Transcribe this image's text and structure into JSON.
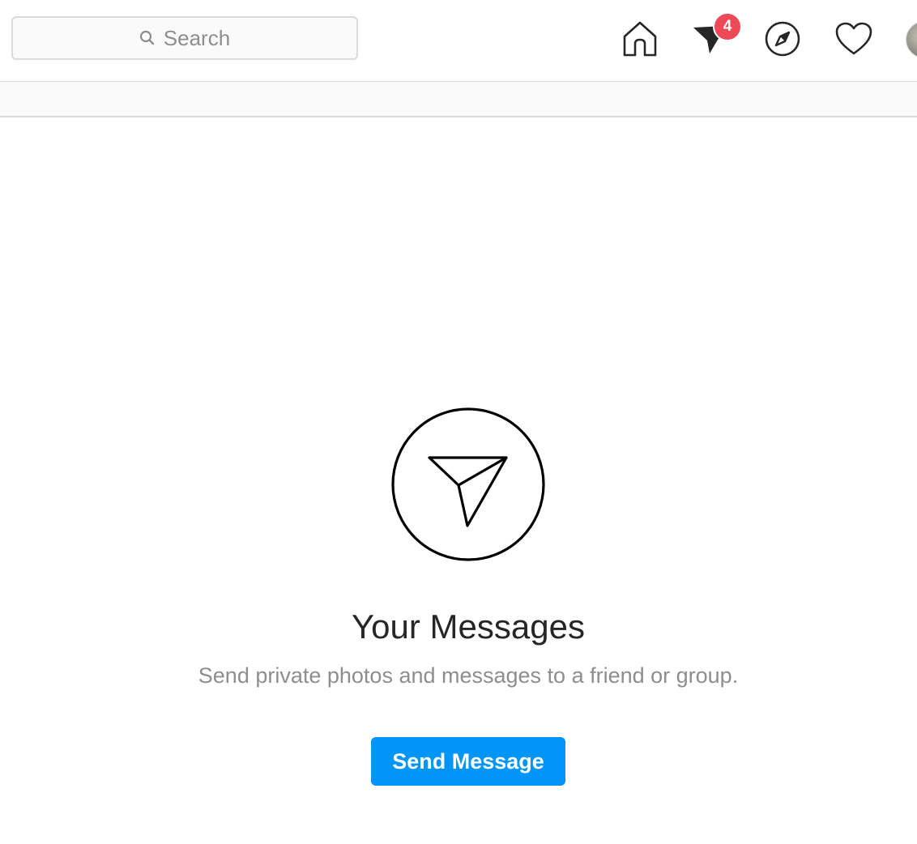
{
  "header": {
    "search": {
      "placeholder": "Search",
      "icon": "search-icon"
    },
    "nav": [
      {
        "name": "home",
        "icon": "home-icon"
      },
      {
        "name": "direct",
        "icon": "paper-plane-icon",
        "badge": "4"
      },
      {
        "name": "explore",
        "icon": "compass-icon"
      },
      {
        "name": "activity",
        "icon": "heart-icon"
      },
      {
        "name": "profile",
        "icon": "avatar"
      }
    ]
  },
  "empty_state": {
    "icon": "paper-plane-circle-icon",
    "title": "Your Messages",
    "subtitle": "Send private photos and messages to a friend or group.",
    "button_label": "Send Message"
  },
  "colors": {
    "badge": "#ed4956",
    "button": "#0095f6",
    "muted_text": "#8e8e8e",
    "border": "#dbdbdb"
  }
}
